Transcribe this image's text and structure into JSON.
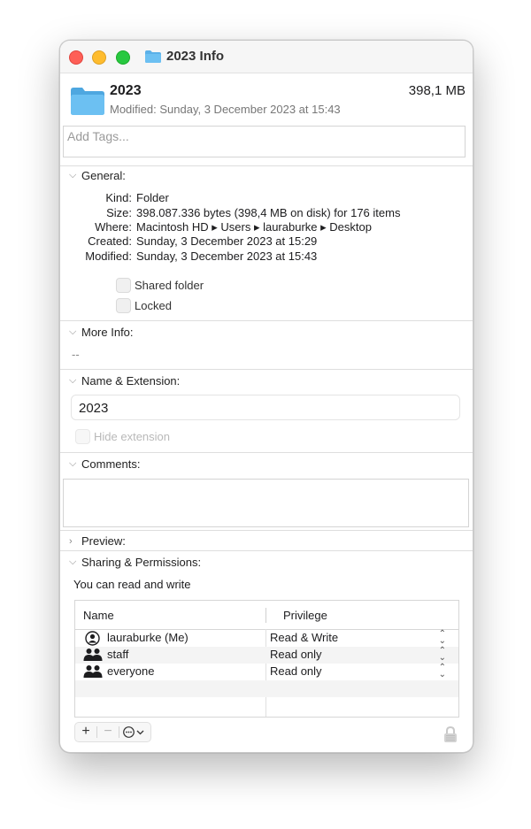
{
  "window": {
    "title": "2023  Info"
  },
  "header": {
    "name": "2023",
    "size": "398,1 MB",
    "modified": "Modified: Sunday, 3 December 2023 at 15:43"
  },
  "tags": {
    "placeholder": "Add Tags..."
  },
  "general": {
    "heading": "General:",
    "rows": [
      {
        "key": "Kind:",
        "value": "Folder"
      },
      {
        "key": "Size:",
        "value": "398.087.336 bytes (398,4 MB on disk) for 176 items"
      },
      {
        "key": "Where:",
        "value": "Macintosh HD ▸ Users ▸ lauraburke ▸ Desktop"
      },
      {
        "key": "Created:",
        "value": "Sunday, 3 December 2023 at 15:29"
      },
      {
        "key": "Modified:",
        "value": "Sunday, 3 December 2023 at 15:43"
      }
    ],
    "shared_folder": "Shared folder",
    "locked": "Locked"
  },
  "more_info": {
    "heading": "More Info:",
    "value": "--"
  },
  "name_extension": {
    "heading": "Name & Extension:",
    "value": "2023",
    "hide_extension": "Hide extension"
  },
  "comments": {
    "heading": "Comments:"
  },
  "preview": {
    "heading": "Preview:"
  },
  "sharing": {
    "heading": "Sharing & Permissions:",
    "status": "You can read and write",
    "col_name": "Name",
    "col_privilege": "Privilege",
    "rows": [
      {
        "name": "lauraburke (Me)",
        "privilege": "Read & Write",
        "icon": "user-icon"
      },
      {
        "name": "staff",
        "privilege": "Read only",
        "icon": "group-icon"
      },
      {
        "name": "everyone",
        "privilege": "Read only",
        "icon": "group-icon"
      }
    ]
  },
  "colors": {
    "folder": "#5ab0e8",
    "close": "#fe5f57",
    "minimize": "#febc2e",
    "zoom": "#28c840"
  }
}
